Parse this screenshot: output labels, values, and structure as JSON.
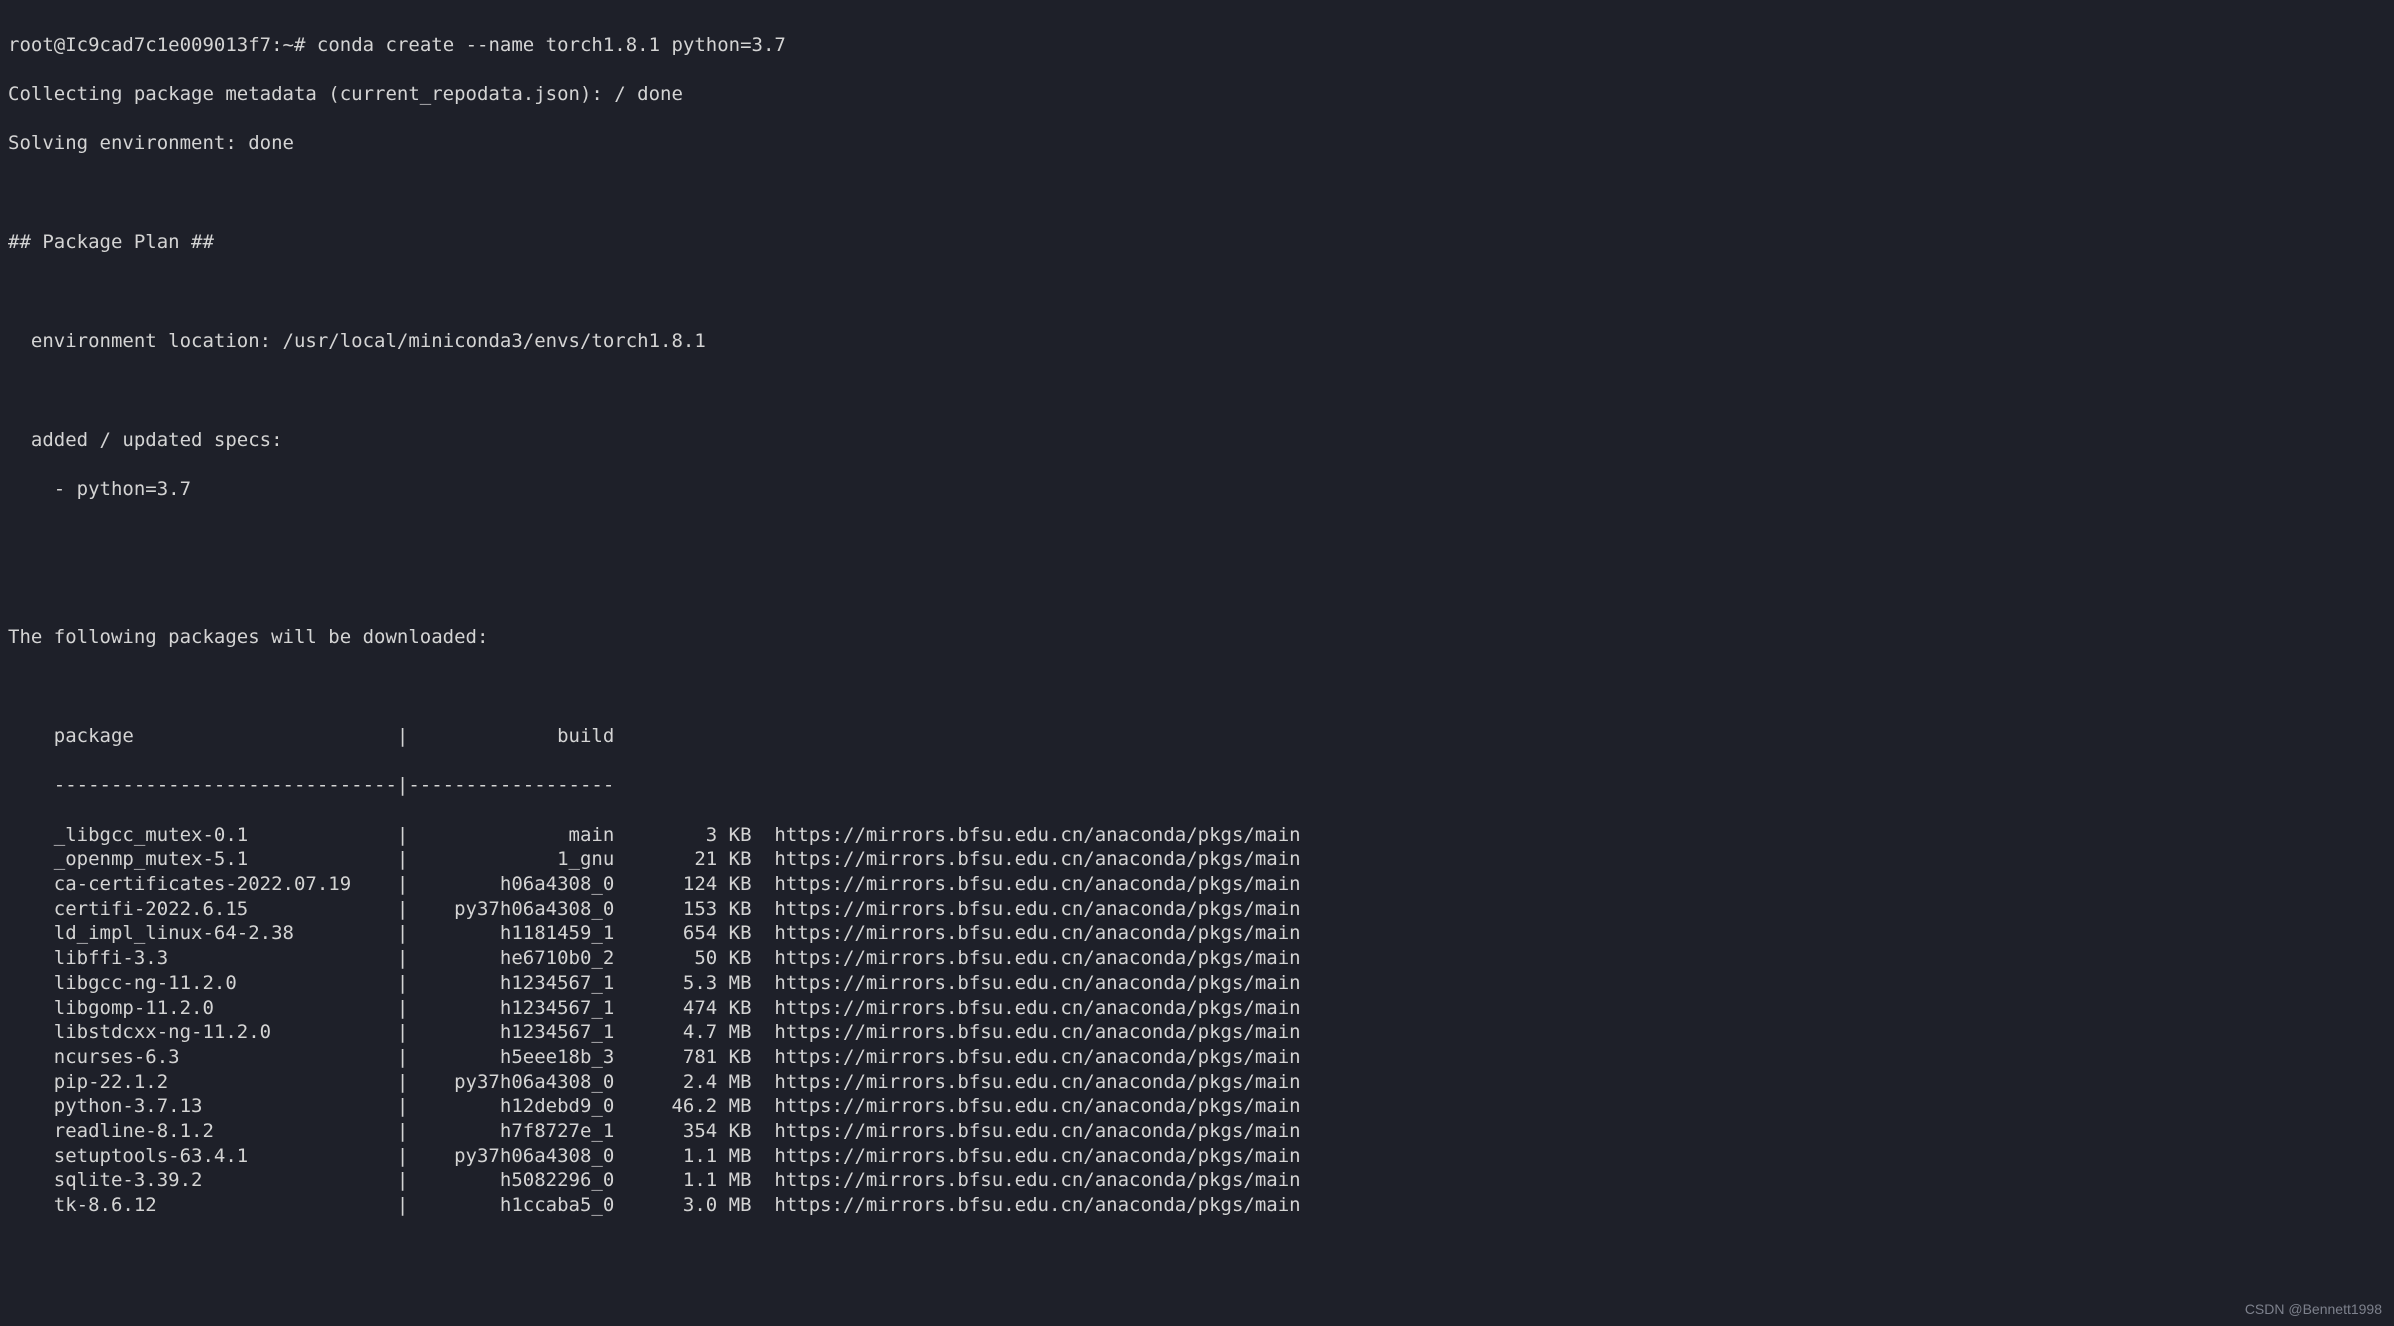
{
  "prompt": "root@Ic9cad7c1e009013f7:~#",
  "command": "conda create --name torch1.8.1 python=3.7",
  "collecting_line": "Collecting package metadata (current_repodata.json): / done",
  "solving_line": "Solving environment: done",
  "plan_header": "## Package Plan ##",
  "env_location_label": "  environment location: ",
  "env_location_value": "/usr/local/miniconda3/envs/torch1.8.1",
  "specs_header": "  added / updated specs:",
  "specs_item": "    - python=3.7",
  "download_header": "The following packages will be downloaded:",
  "table_header_package": "    package",
  "table_header_build": "build",
  "table_separator_left": "    ---------------------------",
  "table_separator_right": "-----------------",
  "channel_url": "https://mirrors.bfsu.edu.cn/anaconda/pkgs/main",
  "packages": [
    {
      "name": "_libgcc_mutex-0.1",
      "build": "main",
      "size": "3 KB"
    },
    {
      "name": "_openmp_mutex-5.1",
      "build": "1_gnu",
      "size": "21 KB"
    },
    {
      "name": "ca-certificates-2022.07.19",
      "build": "h06a4308_0",
      "size": "124 KB"
    },
    {
      "name": "certifi-2022.6.15",
      "build": "py37h06a4308_0",
      "size": "153 KB"
    },
    {
      "name": "ld_impl_linux-64-2.38",
      "build": "h1181459_1",
      "size": "654 KB"
    },
    {
      "name": "libffi-3.3",
      "build": "he6710b0_2",
      "size": "50 KB"
    },
    {
      "name": "libgcc-ng-11.2.0",
      "build": "h1234567_1",
      "size": "5.3 MB"
    },
    {
      "name": "libgomp-11.2.0",
      "build": "h1234567_1",
      "size": "474 KB"
    },
    {
      "name": "libstdcxx-ng-11.2.0",
      "build": "h1234567_1",
      "size": "4.7 MB"
    },
    {
      "name": "ncurses-6.3",
      "build": "h5eee18b_3",
      "size": "781 KB"
    },
    {
      "name": "pip-22.1.2",
      "build": "py37h06a4308_0",
      "size": "2.4 MB"
    },
    {
      "name": "python-3.7.13",
      "build": "h12debd9_0",
      "size": "46.2 MB"
    },
    {
      "name": "readline-8.1.2",
      "build": "h7f8727e_1",
      "size": "354 KB"
    },
    {
      "name": "setuptools-63.4.1",
      "build": "py37h06a4308_0",
      "size": "1.1 MB"
    },
    {
      "name": "sqlite-3.39.2",
      "build": "h5082296_0",
      "size": "1.1 MB"
    },
    {
      "name": "tk-8.6.12",
      "build": "h1ccaba5_0",
      "size": "3.0 MB"
    }
  ],
  "watermark": "CSDN @Bennett1998",
  "share_badge": ""
}
